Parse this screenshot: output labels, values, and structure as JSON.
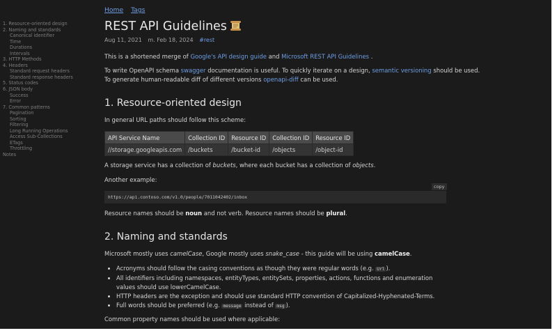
{
  "toc": [
    {
      "label": "1. Resource-oriented design",
      "level": 1
    },
    {
      "label": "2. Naming and standards",
      "level": 1
    },
    {
      "label": "Canonical identifier",
      "level": 2
    },
    {
      "label": "Time",
      "level": 2
    },
    {
      "label": "Durations",
      "level": 2
    },
    {
      "label": "Intervals",
      "level": 2
    },
    {
      "label": "3. HTTP Methods",
      "level": 1
    },
    {
      "label": "4. Headers",
      "level": 1
    },
    {
      "label": "Standard request headers",
      "level": 2
    },
    {
      "label": "Standard response headers",
      "level": 2
    },
    {
      "label": "5. Status codes",
      "level": 1
    },
    {
      "label": "6. JSON body",
      "level": 1
    },
    {
      "label": "Success",
      "level": 2
    },
    {
      "label": "Error",
      "level": 2
    },
    {
      "label": "7. Common patterns",
      "level": 1
    },
    {
      "label": "Pagination",
      "level": 2
    },
    {
      "label": "Sorting",
      "level": 2
    },
    {
      "label": "Filtering",
      "level": 2
    },
    {
      "label": "Long Running Operations",
      "level": 2
    },
    {
      "label": "Access Sub-Collections",
      "level": 2
    },
    {
      "label": "ETags",
      "level": 2
    },
    {
      "label": "Throttling",
      "level": 2
    },
    {
      "label": "Notes",
      "level": 1
    }
  ],
  "nav": {
    "home": "Home",
    "tags": "Tags"
  },
  "title": "REST API Guidelines",
  "meta": {
    "date": "Aug 11, 2021",
    "modified": "m. Feb 18, 2024",
    "tag": "#rest"
  },
  "intro": {
    "p1_a": "This is a shortened merge of ",
    "p1_link1": "Google's API design guide",
    "p1_b": " and ",
    "p1_link2": "Microsoft REST API Guidelines",
    "p1_c": " .",
    "p2_a": "To write OpenAPI schema ",
    "p2_link1": "swagger",
    "p2_b": " documentation is useful. To quickly iterate on a design, ",
    "p2_link2": "semantic versioning",
    "p2_c": " should be used.",
    "p3_a": "To generate human-readable diff of different versions ",
    "p3_link": "openapi-diff",
    "p3_b": " can be used."
  },
  "section1": {
    "heading": "1. Resource-oriented design",
    "p1": "In general URL paths should follow this scheme:",
    "table": {
      "headers": [
        "API Service Name",
        "Collection ID",
        "Resource ID",
        "Collection ID",
        "Resource ID"
      ],
      "row": [
        "//storage.googleapis.com",
        "/buckets",
        "/bucket-id",
        "/objects",
        "/object-id"
      ]
    },
    "p2_a": "A storage service has a collection of ",
    "p2_em1": "buckets",
    "p2_b": ", where each bucket has a collection of ",
    "p2_em2": "objects",
    "p2_c": ".",
    "p3": "Another example:",
    "copy_label": "copy",
    "code": "https://api.contoso.com/v1.0/people/7011042402/inbox",
    "p4_a": "Resource names should be ",
    "p4_b1": "noun",
    "p4_c": " and not verb. Resource names should be ",
    "p4_b2": "plural",
    "p4_d": "."
  },
  "section2": {
    "heading": "2. Naming and standards",
    "p1_a": "Microsoft mostly uses ",
    "p1_em1": "camelCase",
    "p1_b": ", Google mostly uses ",
    "p1_em2": "snake_case",
    "p1_c": " - this guide will be using ",
    "p1_strong": "camelCase",
    "p1_d": ".",
    "b1_a": "Acronyms should follow the casing conventions as though they were regular words (e.g. ",
    "b1_code": "Url",
    "b1_b": ").",
    "b2": "All identifiers including namespaces, entityTypes, entitySets, properties, actions, functions and enumeration values should use lowerCamelCase.",
    "b3": "HTTP headers are the exception and should use standard HTTP convention of Capitalized-Hyphenated-Terms.",
    "b4_a": "Full words should be preferred (e.g. ",
    "b4_code1": "message",
    "b4_b": " instead of ",
    "b4_code2": "msg",
    "b4_c": ").",
    "p2": "Common property names should be used where applicable:"
  },
  "icons": {
    "title_icon": "scroll-icon"
  }
}
